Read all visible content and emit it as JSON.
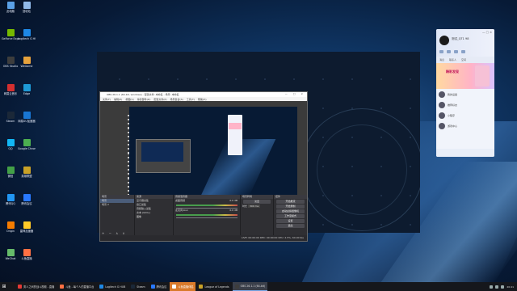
{
  "desktop_icons": [
    {
      "label": "此电脑",
      "color": "#5aa0e6"
    },
    {
      "label": "回收站",
      "color": "#8fb8e8"
    },
    {
      "label": "GeForce Experience",
      "color": "#76b900"
    },
    {
      "label": "Logitech G HUB",
      "color": "#1e88e5"
    },
    {
      "label": "OBS Studio",
      "color": "#3d3d3d"
    },
    {
      "label": "WeGame",
      "color": "#e6a23c"
    },
    {
      "label": "网易云音乐",
      "color": "#d32f2f"
    },
    {
      "label": "Edge",
      "color": "#1e9ad6"
    },
    {
      "label": "Steam",
      "color": "#1b2838"
    },
    {
      "label": "网易UU加速器",
      "color": "#1976d2"
    },
    {
      "label": "QQ",
      "color": "#12b7f5"
    },
    {
      "label": "Google Chrome",
      "color": "#4caf50"
    },
    {
      "label": "微信",
      "color": "#43a047"
    },
    {
      "label": "英雄联盟",
      "color": "#c9a227"
    },
    {
      "label": "腾讯QQ",
      "color": "#2196f3"
    },
    {
      "label": "腾讯会议",
      "color": "#2979ff"
    },
    {
      "label": "Origin",
      "color": "#f57c00"
    },
    {
      "label": "雷神加速器",
      "color": "#ffca28"
    },
    {
      "label": "WeChat",
      "color": "#66bb6a"
    },
    {
      "label": "斗鱼直播",
      "color": "#ff7043"
    }
  ],
  "chat_panel": {
    "username": "测试_QT1 98",
    "window_controls": "— □ ×",
    "tabs": [
      "消息",
      "联系人",
      "空间"
    ],
    "banner_text": "精彩发现",
    "list_items": [
      "我的设备",
      "推荐好友",
      "小程序",
      "游戏中心"
    ]
  },
  "obs": {
    "title": "OBS 26.1.1 (64-bit, windows) - 配置文件: 未命名 - 场景: 未命名",
    "window_controls": "— □ ×",
    "menu": [
      "文件(F)",
      "编辑(E)",
      "视图(V)",
      "停靠部件(D)",
      "配置文件(P)",
      "场景集合(S)",
      "工具(T)",
      "帮助(H)"
    ],
    "docks": {
      "scenes": {
        "title": "场景",
        "items": [
          "场景",
          "场景 2"
        ]
      },
      "sources": {
        "title": "来源",
        "items": [
          "显示器采集",
          "窗口采集",
          "音频输入采集",
          "文本 (GDI+)",
          "图像"
        ]
      },
      "mixer": {
        "title": "音频混音器",
        "channels": [
          "桌面音频",
          "麦克风/Aux"
        ],
        "levels": [
          "0.0 dB",
          "0.0 dB"
        ]
      },
      "transitions": {
        "title": "场景转场",
        "type": "淡出",
        "duration_label": "时长",
        "duration": "300 ms"
      },
      "controls": {
        "title": "控件",
        "buttons": [
          "开始推流",
          "开始录制",
          "启动虚拟摄像机",
          "工作室模式",
          "设置",
          "退出"
        ]
      }
    },
    "status": "LIVE: 00:00:00  REC: 00:00:00  CPU: 2.5%, 60.00 fps"
  },
  "taskbar": {
    "items": [
      {
        "label": "男人之间的战斗视频 - 直播",
        "color": "#e53935",
        "active": false,
        "orange": false
      },
      {
        "label": "斗鱼 - 每个人的直播平台",
        "color": "#ff7043",
        "active": false,
        "orange": false
      },
      {
        "label": "Logitech G HUB",
        "color": "#1e88e5",
        "active": false,
        "orange": false
      },
      {
        "label": "Steam",
        "color": "#1b2838",
        "active": false,
        "orange": false
      },
      {
        "label": "腾讯会议",
        "color": "#2979ff",
        "active": false,
        "orange": false
      },
      {
        "label": "斗鱼直播伴侣",
        "color": "#ffffff",
        "active": false,
        "orange": true
      },
      {
        "label": "League of Legends",
        "color": "#c9a227",
        "active": false,
        "orange": false
      },
      {
        "label": "OBS 26.1.1 (64-bit)",
        "color": "#3d3d3d",
        "active": true,
        "orange": false
      }
    ],
    "tray_time": "20:41"
  }
}
